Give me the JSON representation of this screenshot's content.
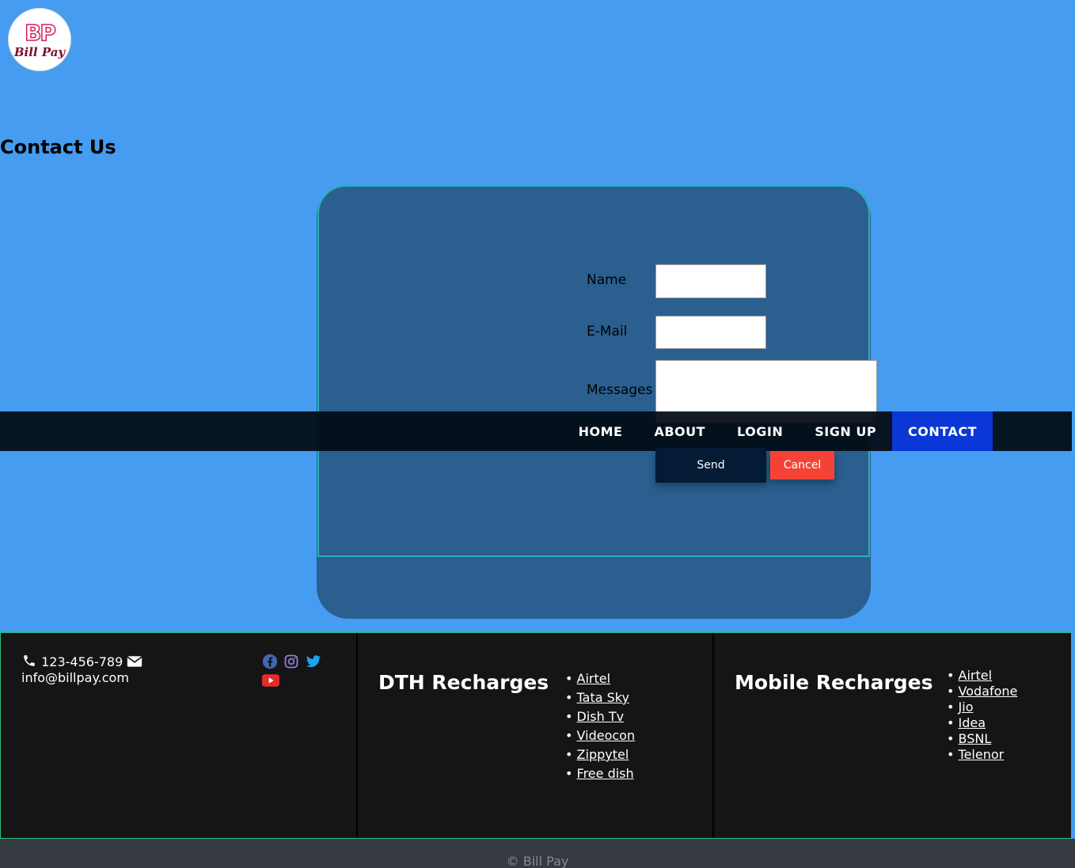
{
  "logo": {
    "mark": "BP",
    "name": "Bill Pay"
  },
  "page_title": "Contact Us",
  "form": {
    "name_label": "Name",
    "email_label": "E-Mail",
    "messages_label": "Messages",
    "name_value": "",
    "email_value": "",
    "messages_value": "",
    "send_label": "Send",
    "cancel_label": "Cancel"
  },
  "nav": {
    "items": [
      {
        "label": "HOME"
      },
      {
        "label": "ABOUT"
      },
      {
        "label": "LOGIN"
      },
      {
        "label": "SIGN UP"
      },
      {
        "label": "CONTACT",
        "active": true
      }
    ]
  },
  "footer": {
    "phone": "123-456-789",
    "email": "info@billpay.com",
    "socials": [
      "facebook-icon",
      "instagram-icon",
      "twitter-icon",
      "youtube-icon"
    ],
    "dth": {
      "title": "DTH Recharges",
      "items": [
        "Airtel",
        "Tata Sky",
        "Dish Tv",
        "Videocon",
        "Zippytel",
        "Free dish"
      ]
    },
    "mobile": {
      "title": "Mobile Recharges",
      "items": [
        "Airtel",
        "Vodafone",
        "Jio",
        "Idea",
        "BSNL",
        "Telenor"
      ]
    }
  },
  "copyright": "© Bill Pay",
  "colors": {
    "page_bg": "#459cf0",
    "form_bg": "#2a5f8f",
    "navbar_bg": "#020a14",
    "nav_active": "#0a37d6",
    "send_bg": "#031b35",
    "cancel_bg": "#f44336",
    "footer_bg": "#151515",
    "bottom_bg": "#343a40"
  }
}
